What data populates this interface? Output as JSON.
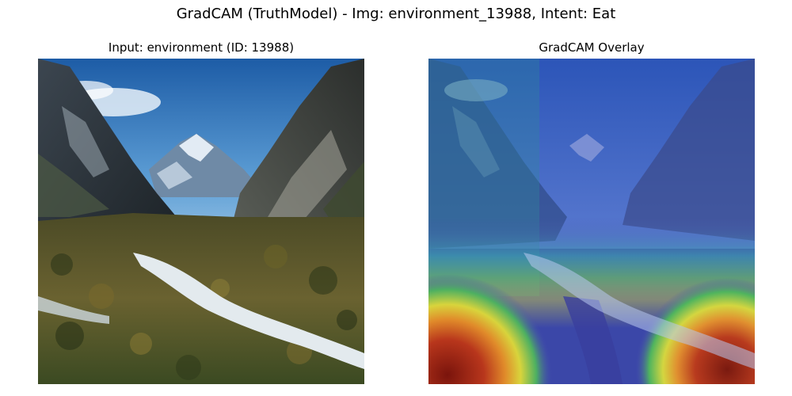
{
  "figure": {
    "title": "GradCAM (TruthModel) - Img: environment_13988, Intent: Eat"
  },
  "panels": [
    {
      "title": "Input: environment (ID: 13988)",
      "image": "mountain-valley-photo"
    },
    {
      "title": "GradCAM Overlay",
      "image": "gradcam-heatmap-overlay-photo"
    }
  ],
  "colors": {
    "sky_top": "#1f5fa8",
    "sky_bottom": "#8fc0e6",
    "mountain_dark": "#2e3438",
    "snow": "#d9e4ef",
    "grass": "#5a5a2a",
    "river": "#e8eef2",
    "heat_red": "#8a1a10",
    "heat_yellow": "#e6d43a",
    "heat_green": "#3fa55a",
    "heat_blue": "#3a3aa0"
  }
}
